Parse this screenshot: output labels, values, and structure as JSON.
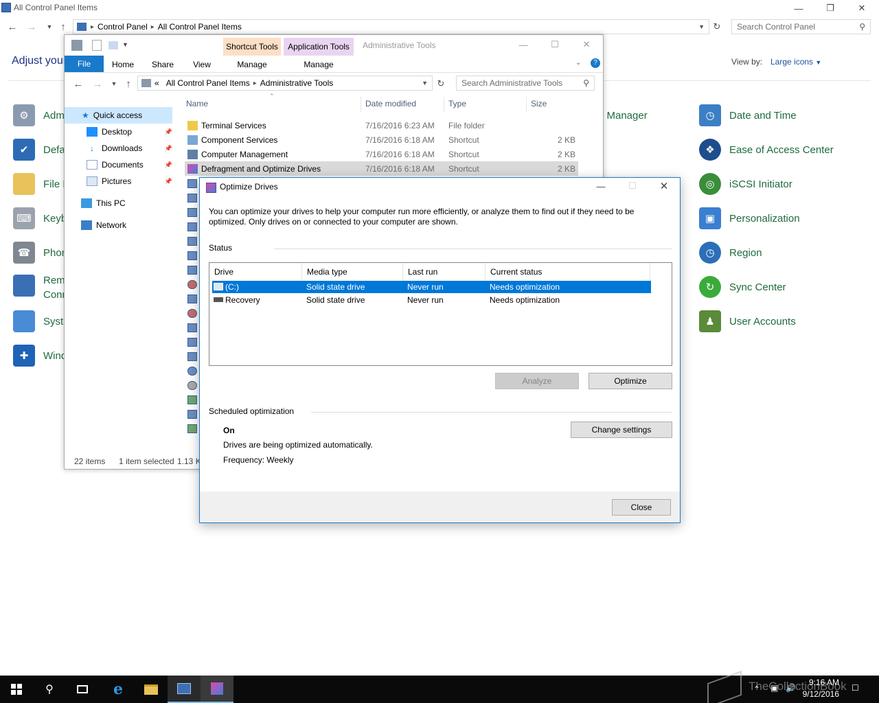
{
  "control_panel": {
    "window_title": "All Control Panel Items",
    "breadcrumb": [
      "Control Panel",
      "All Control Panel Items"
    ],
    "search_placeholder": "Search Control Panel",
    "heading": "Adjust your",
    "view_by_label": "View by:",
    "view_by_value": "Large icons",
    "left_items": [
      "Adm",
      "Defa",
      "File E",
      "Keyb",
      "Phon",
      "Rem",
      "Conn",
      "Syste",
      "Wind"
    ],
    "right_items": [
      {
        "label": "Date and Time",
        "icon": "clock-calendar-icon",
        "color": "#3c7fc6"
      },
      {
        "label": "Ease of Access Center",
        "icon": "ease-of-access-icon",
        "color": "#1e4d8c"
      },
      {
        "label": "iSCSI Initiator",
        "icon": "iscsi-globe-icon",
        "color": "#3a8d3a"
      },
      {
        "label": "Personalization",
        "icon": "monitor-icon",
        "color": "#3a7fd0"
      },
      {
        "label": "Region",
        "icon": "region-globe-icon",
        "color": "#2c6fb8"
      },
      {
        "label": "Sync Center",
        "icon": "sync-icon",
        "color": "#3aab3a"
      },
      {
        "label": "User Accounts",
        "icon": "users-icon",
        "color": "#5a8a3a"
      }
    ],
    "partial_label": "l Manager"
  },
  "explorer": {
    "window_title": "Administrative Tools",
    "context_tabs": {
      "shortcut_tools": "Shortcut Tools",
      "application_tools": "Application Tools"
    },
    "ribbon_tabs": [
      "File",
      "Home",
      "Share",
      "View",
      "Manage",
      "Manage"
    ],
    "breadcrumb": {
      "prefix": "«",
      "items": [
        "All Control Panel Items",
        "Administrative Tools"
      ]
    },
    "search_placeholder": "Search Administrative Tools",
    "nav_pane": {
      "quick_access": "Quick access",
      "pinned": [
        "Desktop",
        "Downloads",
        "Documents",
        "Pictures"
      ],
      "this_pc": "This PC",
      "network": "Network"
    },
    "columns": [
      "Name",
      "Date modified",
      "Type",
      "Size"
    ],
    "files": [
      {
        "name": "Terminal Services",
        "date": "7/16/2016 6:23 AM",
        "type": "File folder",
        "size": ""
      },
      {
        "name": "Component Services",
        "date": "7/16/2016 6:18 AM",
        "type": "Shortcut",
        "size": "2 KB"
      },
      {
        "name": "Computer Management",
        "date": "7/16/2016 6:18 AM",
        "type": "Shortcut",
        "size": "2 KB"
      },
      {
        "name": "Defragment and Optimize Drives",
        "date": "7/16/2016 6:18 AM",
        "type": "Shortcut",
        "size": "2 KB"
      }
    ],
    "status": {
      "items": "22 items",
      "selected": "1 item selected",
      "size": "1.13 K"
    }
  },
  "dialog": {
    "title": "Optimize Drives",
    "description": "You can optimize your drives to help your computer run more efficiently, or analyze them to find out if they need to be optimized. Only drives on or connected to your computer are shown.",
    "status_label": "Status",
    "columns": [
      "Drive",
      "Media type",
      "Last run",
      "Current status"
    ],
    "drives": [
      {
        "drive": "(C:)",
        "media": "Solid state drive",
        "last_run": "Never run",
        "status": "Needs optimization"
      },
      {
        "drive": "Recovery",
        "media": "Solid state drive",
        "last_run": "Never run",
        "status": "Needs optimization"
      }
    ],
    "analyze_button": "Analyze",
    "optimize_button": "Optimize",
    "scheduled_label": "Scheduled optimization",
    "schedule_state": "On",
    "schedule_desc": "Drives are being optimized automatically.",
    "frequency": "Frequency: Weekly",
    "change_settings_button": "Change settings",
    "close_button": "Close"
  },
  "taskbar": {
    "time": "9:16 AM",
    "date": "9/12/2016",
    "watermark": "TheCollectionBook"
  }
}
